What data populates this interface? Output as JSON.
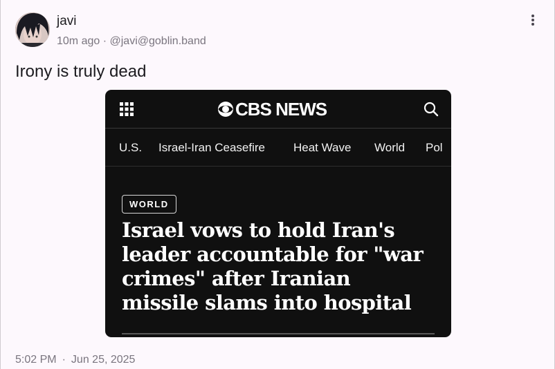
{
  "post": {
    "author_name": "javi",
    "time_ago": "10m ago",
    "handle": "@javi@goblin.band",
    "text": "Irony is truly dead",
    "posted_time": "5:02 PM",
    "posted_date": "Jun 25, 2025"
  },
  "embed": {
    "brand": "CBS NEWS",
    "nav_items": [
      "U.S.",
      "Israel-Iran Ceasefire",
      "Heat Wave",
      "World",
      "Pol"
    ],
    "tag": "WORLD",
    "headline": "Israel vows to hold Iran's leader accountable for \"war crimes\" after Iranian missile slams into hospital"
  },
  "icons": {
    "more": "more-vertical-icon",
    "menu": "grid-menu-icon",
    "logo": "cbs-eye-icon",
    "search": "search-icon"
  },
  "colors": {
    "background": "#fdf8fd",
    "embed_background": "#101010",
    "meta_text": "#7a757f"
  }
}
